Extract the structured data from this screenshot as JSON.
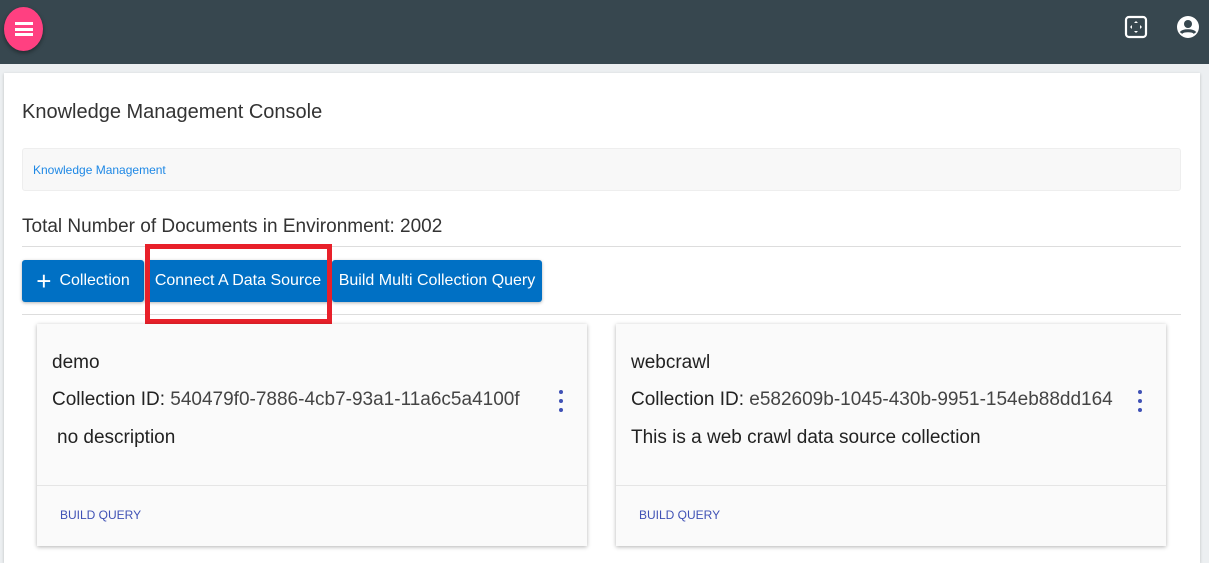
{
  "header": {
    "menu_icon": "hamburger-icon",
    "fullscreen_icon": "fullscreen-icon",
    "account_icon": "account-circle-icon"
  },
  "page": {
    "title": "Knowledge Management Console",
    "breadcrumb": "Knowledge Management",
    "total": "Total Number of Documents in Environment: 2002"
  },
  "toolbar": {
    "collection_plus": "+",
    "collection": "Collection",
    "connect": "Connect A Data Source",
    "multi": "Build Multi Collection Query"
  },
  "cards": [
    {
      "name": "demo",
      "id_label": "Collection ID:",
      "id": "540479f0-7886-4cb7-93a1-11a6c5a4100f",
      "description": "no description",
      "action": "BUILD QUERY"
    },
    {
      "name": "webcrawl",
      "id_label": "Collection ID:",
      "id": "e582609b-1045-430b-9951-154eb88dd164",
      "description": "This is a web crawl data source collection",
      "action": "BUILD QUERY"
    }
  ],
  "colors": {
    "topbar": "#37474f",
    "accent": "#ff4081",
    "primary": "#0070c4",
    "highlight": "#e8202a"
  }
}
